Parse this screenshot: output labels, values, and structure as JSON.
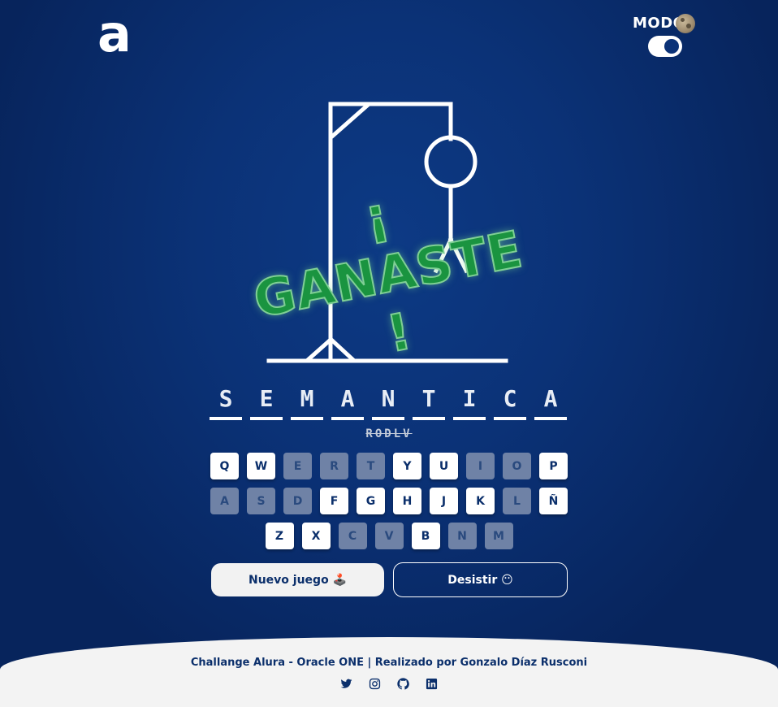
{
  "header": {
    "logo_text": "a",
    "mode_label": "MODO"
  },
  "game": {
    "result_text": "¡ GANASTE !",
    "word_letters": [
      "S",
      "E",
      "M",
      "A",
      "N",
      "T",
      "I",
      "C",
      "A"
    ],
    "wrong_letters": "RODLV"
  },
  "keyboard": {
    "rows": [
      [
        {
          "key": "Q",
          "used": false
        },
        {
          "key": "W",
          "used": false
        },
        {
          "key": "E",
          "used": true
        },
        {
          "key": "R",
          "used": true
        },
        {
          "key": "T",
          "used": true
        },
        {
          "key": "Y",
          "used": false
        },
        {
          "key": "U",
          "used": false
        },
        {
          "key": "I",
          "used": true
        },
        {
          "key": "O",
          "used": true
        },
        {
          "key": "P",
          "used": false
        }
      ],
      [
        {
          "key": "A",
          "used": true
        },
        {
          "key": "S",
          "used": true
        },
        {
          "key": "D",
          "used": true
        },
        {
          "key": "F",
          "used": false
        },
        {
          "key": "G",
          "used": false
        },
        {
          "key": "H",
          "used": false
        },
        {
          "key": "J",
          "used": false
        },
        {
          "key": "K",
          "used": false
        },
        {
          "key": "L",
          "used": true
        },
        {
          "key": "Ñ",
          "used": false
        }
      ],
      [
        {
          "key": "Z",
          "used": false
        },
        {
          "key": "X",
          "used": false
        },
        {
          "key": "C",
          "used": true
        },
        {
          "key": "V",
          "used": true
        },
        {
          "key": "B",
          "used": false
        },
        {
          "key": "N",
          "used": true
        },
        {
          "key": "M",
          "used": true
        }
      ]
    ]
  },
  "actions": {
    "new_game_label": "Nuevo juego 🕹️",
    "quit_label": "Desistir 😶"
  },
  "footer": {
    "credit": "Challange Alura - Oracle ONE | Realizado por Gonzalo Díaz Rusconi",
    "socials": [
      "twitter-icon",
      "instagram-icon",
      "github-icon",
      "linkedin-icon"
    ]
  },
  "colors": {
    "background": "#0b3277",
    "win_text": "#1a9440",
    "key_used": "#6f82a6",
    "footer_bg": "#f3f3f3"
  }
}
